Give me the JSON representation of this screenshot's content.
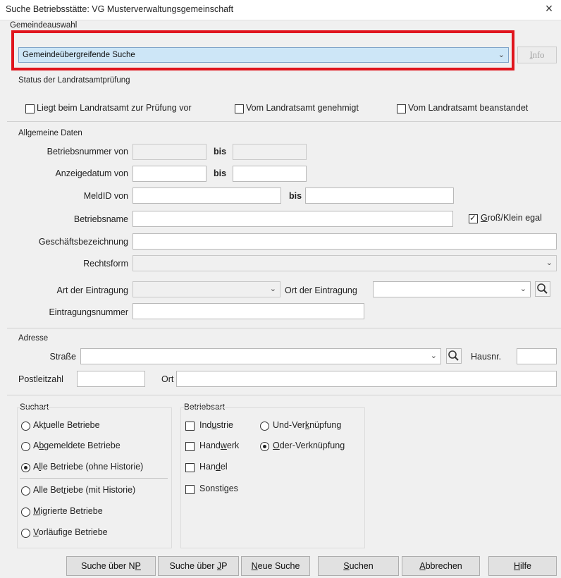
{
  "window": {
    "title": "Suche Betriebsstätte: VG Musterverwaltungsgemeinschaft",
    "close": "×"
  },
  "gemeinde": {
    "label": "Gemeindeauswahl",
    "value": "Gemeindeübergreifende Suche",
    "info_button": "Info"
  },
  "status": {
    "label": "Status der Landratsamtprüfung",
    "options": [
      "Liegt beim Landratsamt zur Prüfung vor",
      "Vom Landratsamt genehmigt",
      "Vom Landratsamt beanstandet"
    ]
  },
  "allgemein": {
    "label": "Allgemeine Daten",
    "betriebsnummer_von": "Betriebsnummer von",
    "anzeigedatum_von": "Anzeigedatum von",
    "meldid_von": "MeldID von",
    "bis": "bis",
    "betriebsname": "Betriebsname",
    "gross_klein": {
      "prefix": "",
      "u": "G",
      "rest": "roß/Klein egal"
    },
    "geschaeftsbezeichnung": "Geschäftsbezeichnung",
    "rechtsform": "Rechtsform",
    "art_der_eintragung": "Art der Eintragung",
    "ort_der_eintragung": "Ort der Eintragung",
    "eintragungsnummer": "Eintragungsnummer"
  },
  "adresse": {
    "label": "Adresse",
    "strasse": "Straße",
    "hausnr": "Hausnr.",
    "postleitzahl": "Postleitzahl",
    "ort": "Ort"
  },
  "suchart": {
    "label": "Suchart",
    "items": [
      {
        "a": "Ak",
        "u": "t",
        "b": "uelle Betriebe"
      },
      {
        "a": "A",
        "u": "b",
        "b": "gemeldete Betriebe"
      },
      {
        "a": "A",
        "u": "l",
        "b": "le Betriebe (ohne Historie)"
      },
      {
        "a": "Alle Bet",
        "u": "r",
        "b": "iebe (mit Historie)"
      },
      {
        "a": "",
        "u": "M",
        "b": "igrierte Betriebe"
      },
      {
        "a": "",
        "u": "V",
        "b": "orläufige Betriebe"
      }
    ]
  },
  "betriebsart": {
    "label": "Betriebsart",
    "items": [
      {
        "a": "Ind",
        "u": "u",
        "b": "strie"
      },
      {
        "a": "Hand",
        "u": "w",
        "b": "erk"
      },
      {
        "a": "Han",
        "u": "d",
        "b": "el"
      },
      {
        "a": "Sonsti",
        "u": "g",
        "b": "es"
      }
    ],
    "verknuepfung": [
      {
        "a": "Und-Ver",
        "u": "k",
        "b": "nüpfung"
      },
      {
        "a": "",
        "u": "O",
        "b": "der-Verknüpfung"
      }
    ]
  },
  "buttons": [
    {
      "a": "Suche über N",
      "u": "P",
      "b": ""
    },
    {
      "a": "Suche über ",
      "u": "J",
      "b": "P"
    },
    {
      "a": "",
      "u": "N",
      "b": "eue Suche"
    },
    {
      "a": "",
      "u": "S",
      "b": "uchen"
    },
    {
      "a": "",
      "u": "A",
      "b": "bbrechen"
    },
    {
      "a": "",
      "u": "H",
      "b": "ilfe"
    }
  ],
  "highlight_color": "#e0151d",
  "selected_combo_color": "#cde6f7"
}
